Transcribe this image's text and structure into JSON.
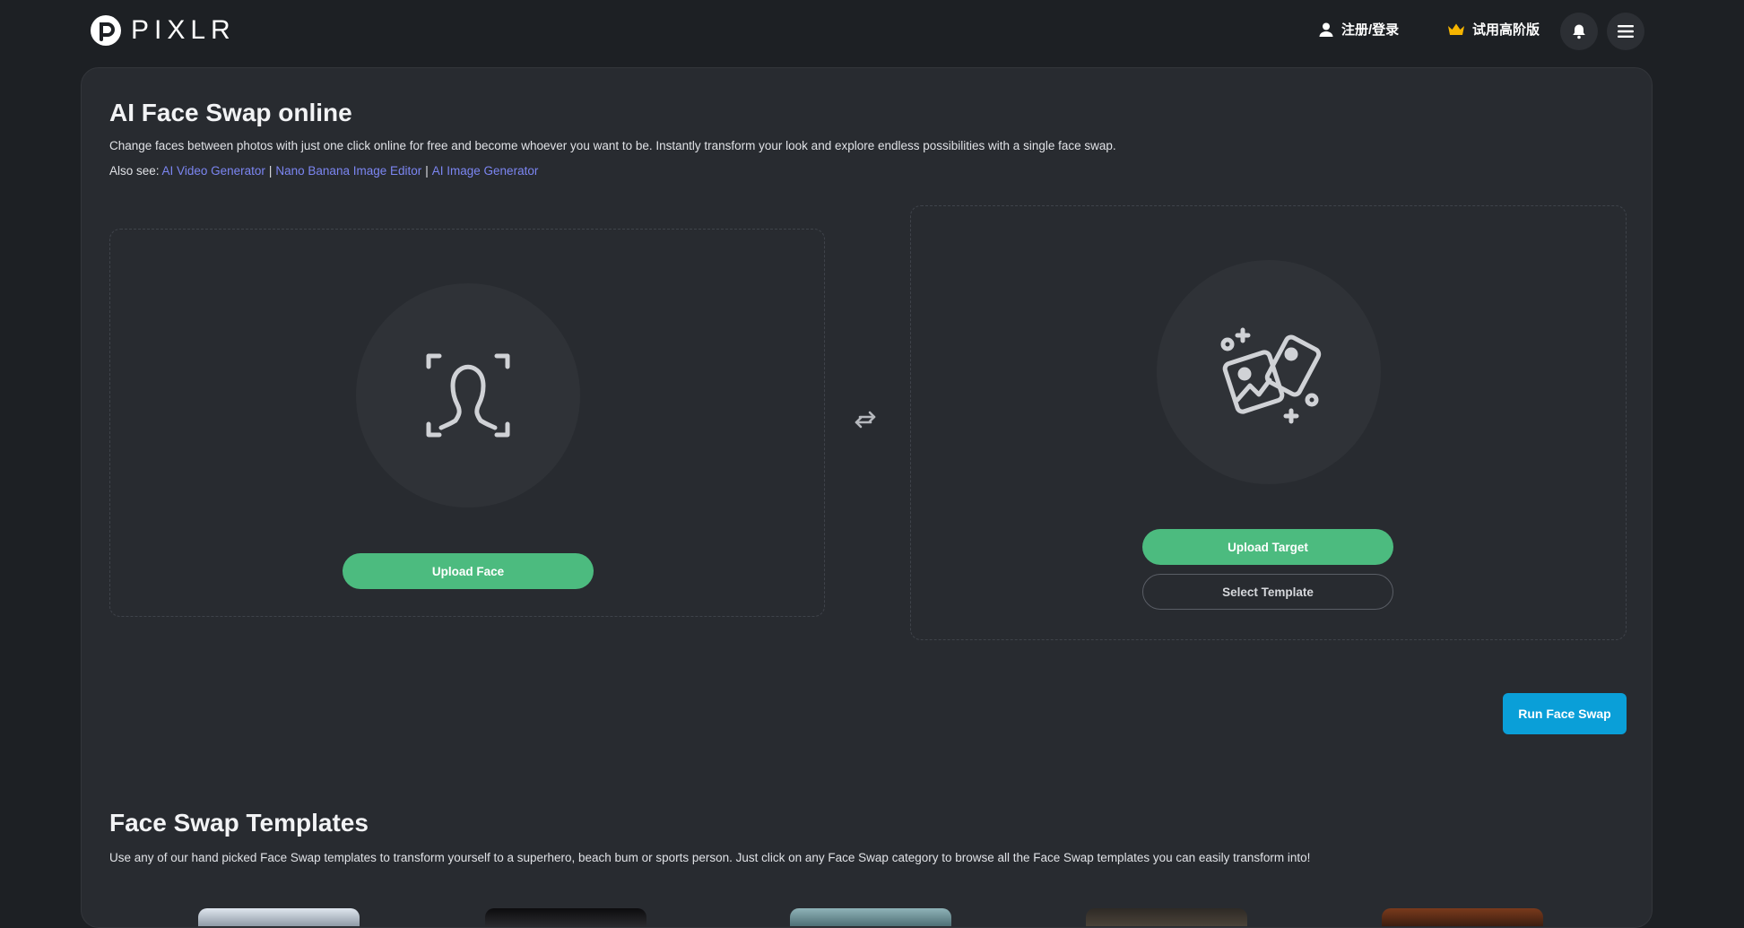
{
  "header": {
    "logo_text": "PIXLR",
    "login_label": "注册/登录",
    "premium_label": "试用高阶版",
    "icons": {
      "login": "user-icon",
      "premium": "crown-icon",
      "notifications": "bell-icon",
      "menu": "hamburger-icon"
    },
    "premium_icon_color": "#f5b400"
  },
  "main": {
    "title": "AI Face Swap online",
    "description": "Change faces between photos with just one click online for free and become whoever you want to be. Instantly transform your look and explore endless possibilities with a single face swap.",
    "also_see_prefix": "Also see:",
    "also_see_links": [
      "AI Video Generator",
      "Nano Banana Image Editor",
      "AI Image Generator"
    ],
    "also_see_separator": "|",
    "face_zone": {
      "icon": "face-scan-icon",
      "upload_label": "Upload Face"
    },
    "swap_icon": "swap-arrows-icon",
    "target_zone": {
      "icon": "images-sparkle-icon",
      "upload_label": "Upload Target",
      "template_label": "Select Template"
    },
    "run_label": "Run Face Swap"
  },
  "templates": {
    "title": "Face Swap Templates",
    "description": "Use any of our hand picked Face Swap templates to transform yourself to a superhero, beach bum or sports person. Just click on any Face Swap category to browse all the Face Swap templates you can easily transform into!"
  },
  "colors": {
    "background": "#1d2024",
    "panel": "#282b30",
    "accent_green": "#4cbb7f",
    "accent_blue": "#0a9fd8",
    "link": "#7c86f2"
  }
}
